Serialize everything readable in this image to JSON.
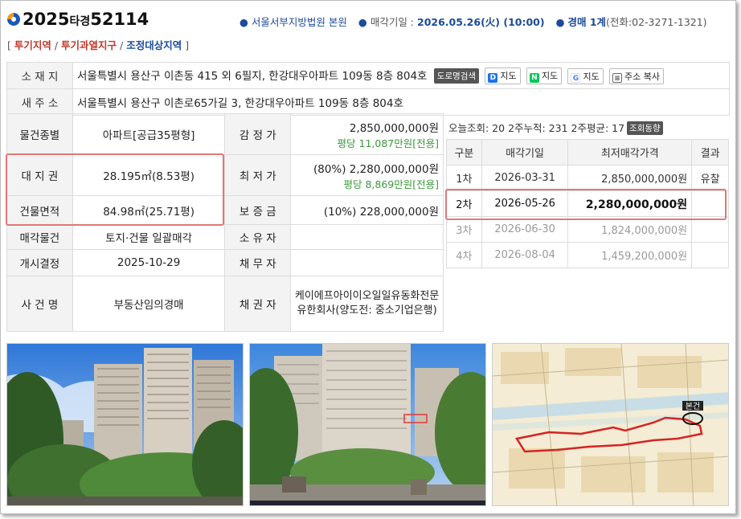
{
  "header": {
    "case_prefix": "2025",
    "case_mid": "타경",
    "case_num": "52114",
    "court": "서울서부지방법원 본원",
    "sale_date_label": "매각기일",
    "sale_date": "2026.05.26(火) (10:00)",
    "dept": "경매 1계",
    "phone": "(전화:02-3271-1321)"
  },
  "zones": [
    "투기지역",
    "투기과열지구",
    "조정대상지역"
  ],
  "address": {
    "label": "소 재 지",
    "value": "서울특별시 용산구 이촌동 415 외 6필지, 한강대우아파트 109동 8층 804호",
    "road_search": "도로명검색",
    "map_daum": "지도",
    "map_naver": "지도",
    "map_google": "지도",
    "copy": "주소 복사",
    "new_label": "새 주 소",
    "new_value": "서울특별시 용산구 이촌로65가길 3, 한강대우아파트 109동 8층 804호"
  },
  "detail": {
    "type_label": "물건종별",
    "type_value": "아파트[공급35평형]",
    "appraisal_label": "감 정 가",
    "appraisal_value": "2,850,000,000원",
    "appraisal_sub": "평당 11,087만원[전용]",
    "land_label": "대 지 권",
    "land_value": "28.195㎡(8.53평)",
    "min_label": "최 저 가",
    "min_value": "(80%) 2,280,000,000원",
    "min_sub": "평당 8,869만원[전용]",
    "bldg_label": "건물면적",
    "bldg_value": "84.98㎡(25.71평)",
    "deposit_label": "보 증 금",
    "deposit_value": "(10%) 228,000,000원",
    "sale_obj_label": "매각물건",
    "sale_obj_value": "토지·건물 일괄매각",
    "owner_label": "소 유 자",
    "owner_value": "",
    "start_label": "개시결정",
    "start_value": "2025-10-29",
    "debtor_label": "채 무 자",
    "debtor_value": "",
    "case_label": "사 건 명",
    "case_value": "부동산임의경매",
    "creditor_label": "채 권 자",
    "creditor_value": "케이에프아이이오일일유동화전문유한회사(양도전: 중소기업은행)"
  },
  "stats": {
    "text": "오늘조회: 20  2주누적: 231  2주평균: 17",
    "trend_btn": "조회동향"
  },
  "schedule": {
    "headers": [
      "구분",
      "매각기일",
      "최저매각가격",
      "결과"
    ],
    "rows": [
      {
        "round": "1차",
        "date": "2026-03-31",
        "price": "2,850,000,000원",
        "result": "유찰"
      },
      {
        "round": "2차",
        "date": "2026-05-26",
        "price": "2,280,000,000원",
        "result": ""
      },
      {
        "round": "3차",
        "date": "2026-06-30",
        "price": "1,824,000,000원",
        "result": ""
      },
      {
        "round": "4차",
        "date": "2026-08-04",
        "price": "1,459,200,000원",
        "result": ""
      }
    ]
  },
  "map_label": "본건",
  "colors": {
    "accent_blue": "#1b4b9b",
    "zone_red": "#c0392b",
    "highlight": "#e07878",
    "green": "#3a9a3a"
  }
}
